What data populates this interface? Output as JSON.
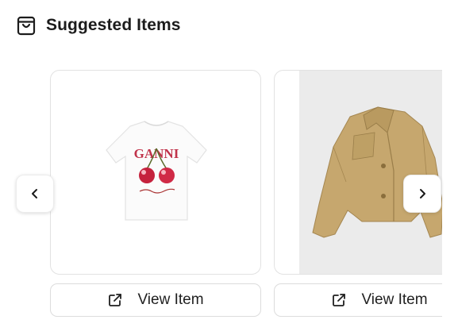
{
  "header": {
    "title": "Suggested Items",
    "icon": "shopping-bag-icon"
  },
  "carousel": {
    "prev_icon": "chevron-left-icon",
    "next_icon": "chevron-right-icon",
    "items": [
      {
        "image_icon": "t-shirt-icon",
        "button_label": "View Item",
        "button_icon": "external-link-icon"
      },
      {
        "image_icon": "jacket-icon",
        "button_label": "View Item",
        "button_icon": "external-link-icon"
      }
    ]
  }
}
